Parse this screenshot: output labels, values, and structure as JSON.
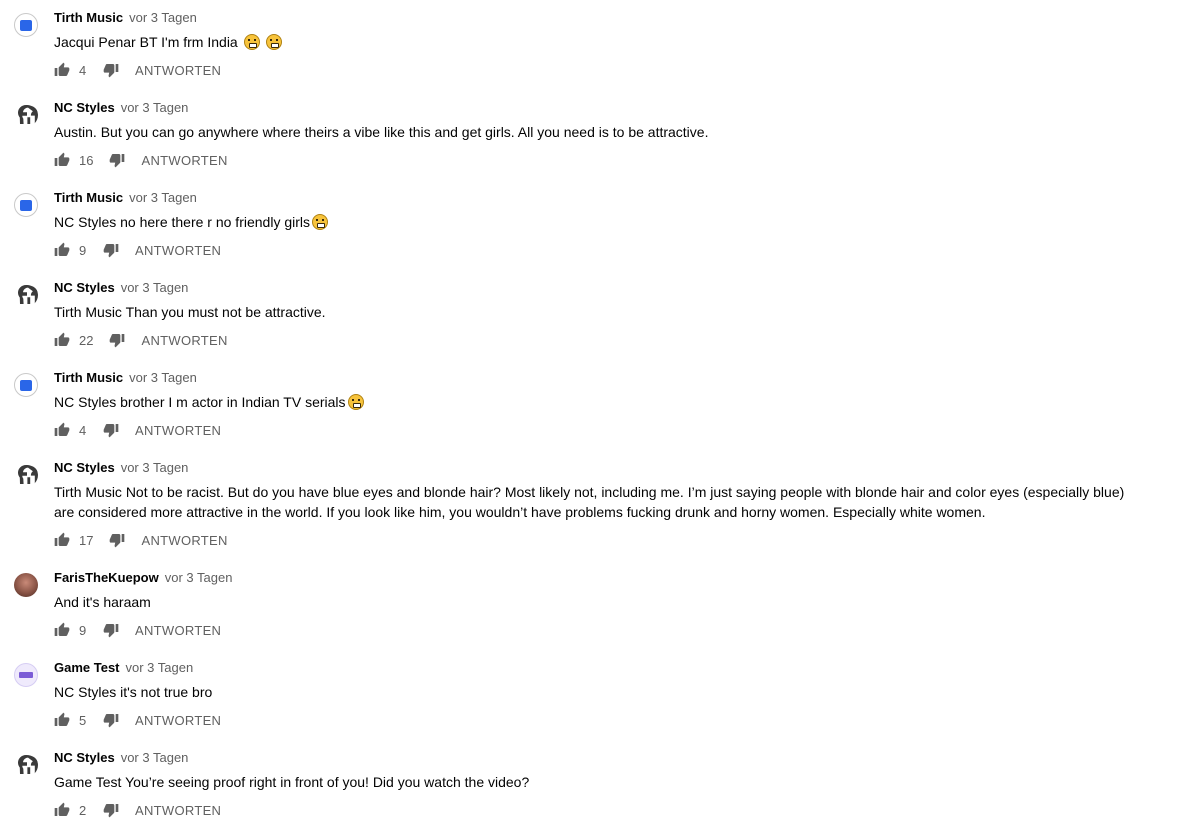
{
  "reply_label": "ANTWORTEN",
  "comments": [
    {
      "author": "Tirth Music",
      "time": "vor 3 Tagen",
      "text": "Jacqui Penar BT I'm frm India",
      "emoji_count": 2,
      "likes": "4",
      "avatar": "tirth"
    },
    {
      "author": "NC Styles",
      "time": "vor 3 Tagen",
      "text": "Austin. But you can go anywhere where theirs a vibe like this and get girls. All you need is to be attractive.",
      "emoji_count": 0,
      "likes": "16",
      "avatar": "nc"
    },
    {
      "author": "Tirth Music",
      "time": "vor 3 Tagen",
      "text": "NC Styles no here there r no friendly girls",
      "emoji_count": 1,
      "likes": "9",
      "avatar": "tirth"
    },
    {
      "author": "NC Styles",
      "time": "vor 3 Tagen",
      "text": "Tirth Music Than you must not be attractive.",
      "emoji_count": 0,
      "likes": "22",
      "avatar": "nc"
    },
    {
      "author": "Tirth Music",
      "time": "vor 3 Tagen",
      "text": "NC Styles brother I m actor in Indian TV serials",
      "emoji_count": 1,
      "likes": "4",
      "avatar": "tirth"
    },
    {
      "author": "NC Styles",
      "time": "vor 3 Tagen",
      "text": "Tirth Music Not to be racist. But do you have blue eyes and blonde hair? Most likely not, including me. I’m just saying people with blonde hair and color eyes (especially blue) are considered more attractive in the world. If you look like him, you wouldn’t have problems fucking drunk and horny women. Especially white women.",
      "emoji_count": 0,
      "likes": "17",
      "avatar": "nc"
    },
    {
      "author": "FarisTheKuepow",
      "time": "vor 3 Tagen",
      "text": "And it's haraam",
      "emoji_count": 0,
      "likes": "9",
      "avatar": "faris"
    },
    {
      "author": "Game Test",
      "time": "vor 3 Tagen",
      "text": "NC Styles it's not true bro",
      "emoji_count": 0,
      "likes": "5",
      "avatar": "game"
    },
    {
      "author": "NC Styles",
      "time": "vor 3 Tagen",
      "text": "Game Test You’re seeing proof right in front of you! Did you watch the video?",
      "emoji_count": 0,
      "likes": "2",
      "avatar": "nc"
    }
  ]
}
